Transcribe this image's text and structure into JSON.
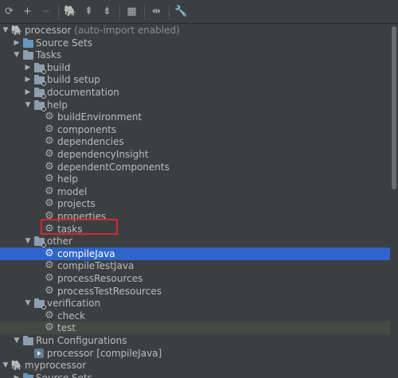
{
  "toolbar": {
    "buttons": [
      {
        "name": "refresh-icon",
        "glyph": "⟳",
        "enabled": true
      },
      {
        "name": "add-icon",
        "glyph": "+",
        "enabled": true
      },
      {
        "name": "remove-icon",
        "glyph": "−",
        "enabled": false
      },
      {
        "name": "gradle-elephant-icon",
        "glyph": "🐘",
        "enabled": true
      },
      {
        "name": "expand-all-icon",
        "glyph": "⇞",
        "enabled": true
      },
      {
        "name": "collapse-all-icon",
        "glyph": "⇟",
        "enabled": true
      },
      {
        "name": "attach-project-icon",
        "glyph": "▦",
        "enabled": true
      },
      {
        "name": "toggle-offline-icon",
        "glyph": "⇹",
        "enabled": true
      },
      {
        "name": "settings-wrench-icon",
        "glyph": "🔧",
        "enabled": true
      }
    ]
  },
  "tree": [
    {
      "label": "processor",
      "suffix": " (auto-import enabled)",
      "depth": 0,
      "arrow": "open",
      "icon": "elephant"
    },
    {
      "label": "Source Sets",
      "depth": 1,
      "arrow": "closed",
      "icon": "folder-blue"
    },
    {
      "label": "Tasks",
      "depth": 1,
      "arrow": "open",
      "icon": "folder"
    },
    {
      "label": "build",
      "depth": 2,
      "arrow": "closed",
      "icon": "folder-cog"
    },
    {
      "label": "build setup",
      "depth": 2,
      "arrow": "closed",
      "icon": "folder-cog"
    },
    {
      "label": "documentation",
      "depth": 2,
      "arrow": "closed",
      "icon": "folder-cog"
    },
    {
      "label": "help",
      "depth": 2,
      "arrow": "open",
      "icon": "folder-cog"
    },
    {
      "label": "buildEnvironment",
      "depth": 3,
      "arrow": "none",
      "icon": "gear"
    },
    {
      "label": "components",
      "depth": 3,
      "arrow": "none",
      "icon": "gear"
    },
    {
      "label": "dependencies",
      "depth": 3,
      "arrow": "none",
      "icon": "gear"
    },
    {
      "label": "dependencyInsight",
      "depth": 3,
      "arrow": "none",
      "icon": "gear"
    },
    {
      "label": "dependentComponents",
      "depth": 3,
      "arrow": "none",
      "icon": "gear"
    },
    {
      "label": "help",
      "depth": 3,
      "arrow": "none",
      "icon": "gear"
    },
    {
      "label": "model",
      "depth": 3,
      "arrow": "none",
      "icon": "gear"
    },
    {
      "label": "projects",
      "depth": 3,
      "arrow": "none",
      "icon": "gear"
    },
    {
      "label": "properties",
      "depth": 3,
      "arrow": "none",
      "icon": "gear"
    },
    {
      "label": "tasks",
      "depth": 3,
      "arrow": "none",
      "icon": "gear"
    },
    {
      "label": "other",
      "depth": 2,
      "arrow": "open",
      "icon": "folder-cog"
    },
    {
      "label": "compileJava",
      "depth": 3,
      "arrow": "none",
      "icon": "gear",
      "state": "selected"
    },
    {
      "label": "compileTestJava",
      "depth": 3,
      "arrow": "none",
      "icon": "gear"
    },
    {
      "label": "processResources",
      "depth": 3,
      "arrow": "none",
      "icon": "gear"
    },
    {
      "label": "processTestResources",
      "depth": 3,
      "arrow": "none",
      "icon": "gear"
    },
    {
      "label": "verification",
      "depth": 2,
      "arrow": "open",
      "icon": "folder-cog"
    },
    {
      "label": "check",
      "depth": 3,
      "arrow": "none",
      "icon": "gear"
    },
    {
      "label": "test",
      "depth": 3,
      "arrow": "none",
      "icon": "gear",
      "state": "hover"
    },
    {
      "label": "Run Configurations",
      "depth": 1,
      "arrow": "open",
      "icon": "folder"
    },
    {
      "label": "processor [compileJava]",
      "depth": 2,
      "arrow": "none",
      "icon": "run-config"
    },
    {
      "label": "myprocessor",
      "depth": 0,
      "arrow": "open",
      "icon": "elephant"
    },
    {
      "label": "Source Sets",
      "depth": 1,
      "arrow": "closed",
      "icon": "folder-blue"
    }
  ],
  "colors": {
    "background": "#3c3f41",
    "selection": "#2f65ca",
    "hover": "#414a43",
    "annotation_box": "#d9262f"
  }
}
